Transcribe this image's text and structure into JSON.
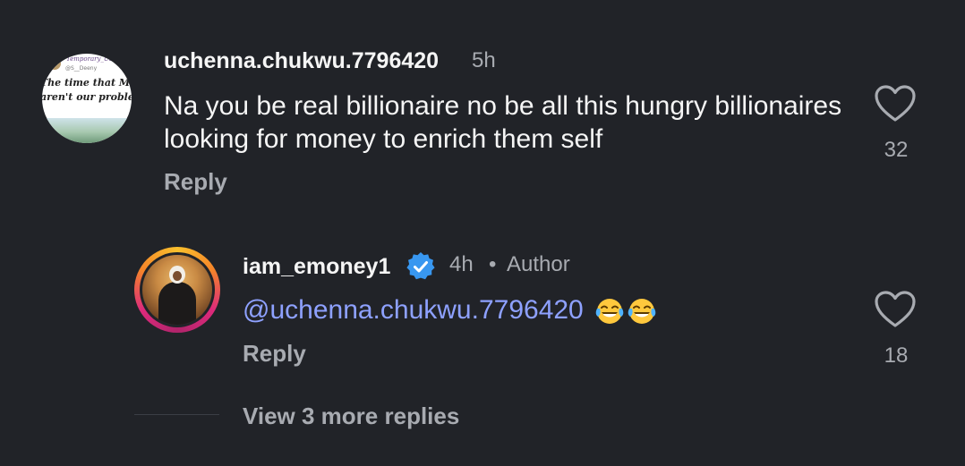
{
  "comments": [
    {
      "username": "uchenna.chukwu.7796420",
      "time": "5h",
      "text": "Na you be real billionaire no be all this hungry billionaires looking for money to enrich them self",
      "reply_label": "Reply",
      "likes": "32",
      "avatar": {
        "handle": "Temporary_Us",
        "at": "@S__Deeny",
        "line1": "The time that Money",
        "line2": "aren't our problems"
      },
      "reply": {
        "username": "iam_emoney1",
        "verified": true,
        "time": "4h",
        "separator": "•",
        "author_badge": "Author",
        "mention": "@uchenna.chukwu.7796420",
        "emojis": [
          "tears-of-joy-emoji",
          "tears-of-joy-emoji"
        ],
        "reply_label": "Reply",
        "likes": "18"
      }
    }
  ],
  "view_more_label": "View 3 more replies",
  "colors": {
    "background": "#212328",
    "primary_text": "#f5f5f5",
    "secondary_text": "#a8abb1",
    "mention": "#8ea1ff",
    "verified_badge": "#3897f0"
  }
}
